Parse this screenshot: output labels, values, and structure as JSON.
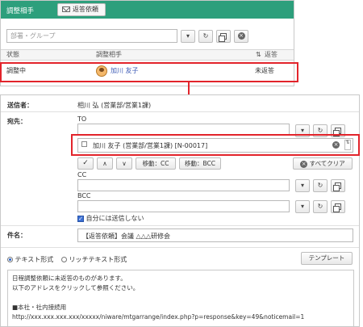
{
  "top_panel": {
    "title": "調整相手",
    "reply_request_button": "返答依頼",
    "group_placeholder": "部署・グループ",
    "columns": {
      "status": "状態",
      "partner": "調整相手",
      "reply": "返答"
    },
    "row": {
      "status": "調整中",
      "partner": "加川 友子",
      "reply": "未返答"
    }
  },
  "form": {
    "sender_label": "送信者：",
    "sender_value": "相川 弘 (営業部/営業1課)",
    "to_header": "宛先：",
    "to_label": "TO",
    "selected_recipient": "加川 友子 (営業部/営業1課) [N-00017]",
    "move_cc": "移動：CC",
    "move_bcc": "移動：BCC",
    "clear_all": "すべてクリア",
    "check_glyph": "✓",
    "up_glyph": "∧",
    "down_glyph": "∨",
    "cc_label": "CC",
    "bcc_label": "BCC",
    "no_self_send": "自分には送信しない",
    "subject_label": "件名：",
    "subject_value": "【返答依頼】会議 △△△研修会",
    "format_text": "テキスト形式",
    "format_rich": "リッチテキスト形式",
    "template_button": "テンプレート",
    "body_lines": [
      "日程調整依頼に未返答のものがあります。",
      "以下のアドレスをクリックして参照ください。",
      "",
      "■本社・社内接続用",
      "http://xxx.xxx.xxx.xxx/xxxxx/niware/mtgarrange/index.php?p=response&key=49&noticemail=1"
    ]
  },
  "icons": {
    "dropdown": "▾",
    "refresh": "↻",
    "clear": "×",
    "sort": "⇅"
  },
  "colors": {
    "header_bg": "#2d9f7c",
    "highlight": "#e2242b",
    "link": "#3b59b5"
  }
}
